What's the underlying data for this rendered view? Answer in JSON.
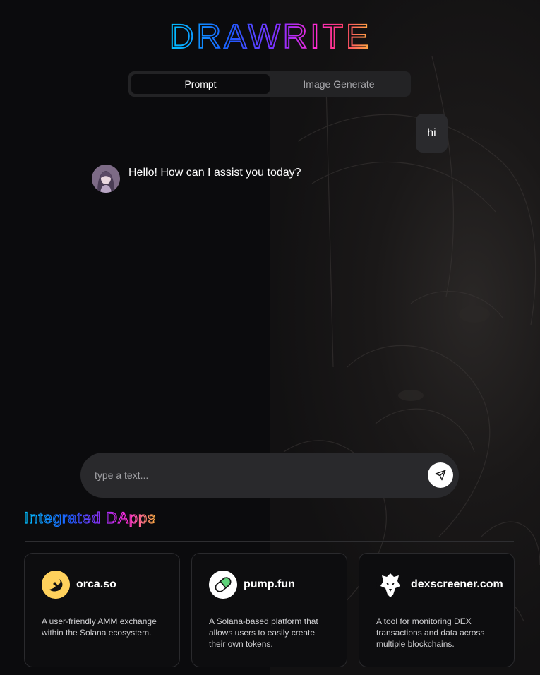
{
  "app": {
    "logo_text": "DRAWRITE",
    "logo_gradient": [
      "#00c2ff",
      "#1e5bff",
      "#7a2cff",
      "#ff2bd6",
      "#ff3b6b",
      "#ffb23d"
    ]
  },
  "mode_switch": {
    "tabs": [
      {
        "label": "Prompt",
        "active": true
      },
      {
        "label": "Image Generate",
        "active": false
      }
    ]
  },
  "chat": {
    "messages": [
      {
        "role": "user",
        "text": "hi"
      },
      {
        "role": "assistant",
        "text": "Hello! How can I assist you today?",
        "avatar_icon": "assistant-avatar"
      }
    ]
  },
  "composer": {
    "placeholder": "type a text...",
    "value": "",
    "send_icon": "send-icon"
  },
  "dapps": {
    "title": "Integrated DApps",
    "items": [
      {
        "name": "orca.so",
        "icon": "orca-logo-icon",
        "description": "A user-friendly AMM exchange within the Solana ecosystem.",
        "icon_color": "#ffd15c"
      },
      {
        "name": "pump.fun",
        "icon": "pill-icon",
        "description": "A Solana-based platform that allows users to easily create their own tokens.",
        "icon_color": "#5fd37a"
      },
      {
        "name": "dexscreener.com",
        "icon": "eagle-icon",
        "description": "A tool for monitoring DEX transactions and data across multiple blockchains.",
        "icon_color": "#ffffff"
      }
    ]
  }
}
